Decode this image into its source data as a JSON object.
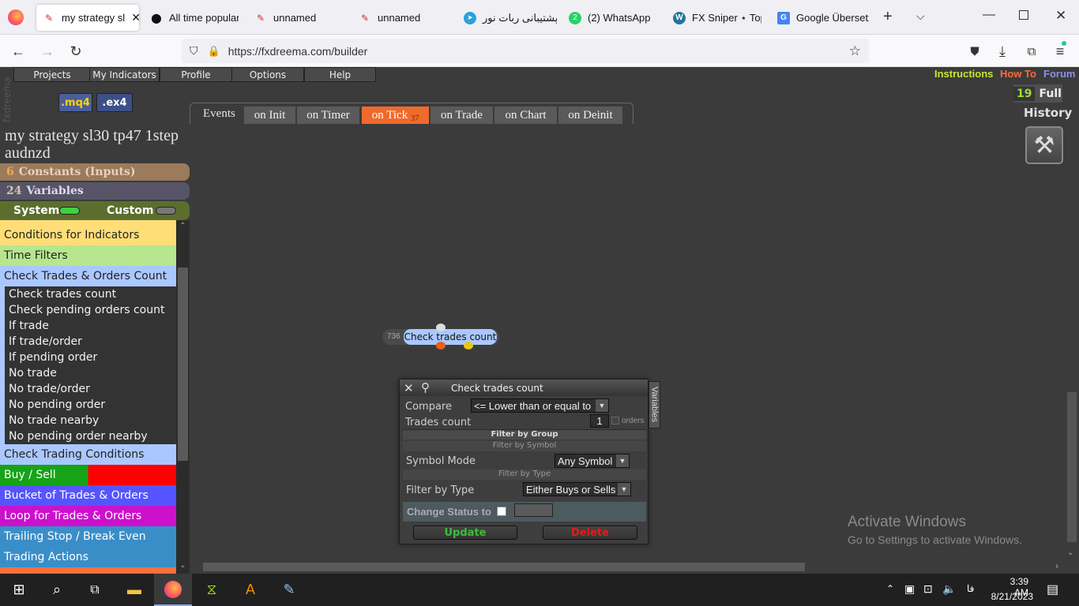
{
  "browser": {
    "tabs": [
      {
        "title": "my strategy sl",
        "active": true
      },
      {
        "title": "All time popular t"
      },
      {
        "title": "unnamed"
      },
      {
        "title": "unnamed"
      },
      {
        "title": "پشتیبانی ربات نور"
      },
      {
        "title": "(2) WhatsApp",
        "badge": "2"
      },
      {
        "title": "FX Sniper ⋆ Top M"
      },
      {
        "title": "Google Übersetze"
      }
    ],
    "url": "https://fxdreema.com/builder"
  },
  "app": {
    "logo": "fxdreema",
    "menu": [
      "Projects",
      "My Indicators",
      "Profile",
      "Options",
      "Help"
    ],
    "links": {
      "instructions": "Instructions",
      "howto": "How To",
      "forum": "Forum"
    },
    "downloads": {
      "mq4": ".mq4",
      "ex4": ".ex4"
    },
    "history": {
      "count": "19",
      "full": "Full",
      "label": "History"
    },
    "event_tabs": {
      "label": "Events",
      "tabs": [
        "on Init",
        "on Timer",
        "on Tick",
        "on Trade",
        "on Chart",
        "on Deinit"
      ],
      "active": "on Tick",
      "tick_badge": "37"
    },
    "strategy_title": "my strategy sl30 tp47 1step audnzd",
    "constants": {
      "count": "6",
      "label": "Constants (Inputs)"
    },
    "variables": {
      "count": "24",
      "label": "Variables"
    },
    "toggles": {
      "system": "System",
      "custom": "Custom"
    },
    "categories": [
      {
        "label": "Conditions for Indicators",
        "color": "#ffdd77"
      },
      {
        "label": "Time Filters",
        "color": "#b8e68e"
      },
      {
        "label": "Check Trades & Orders Count",
        "color": "#aac8ff"
      }
    ],
    "subitems": [
      "Check trades count",
      "Check pending orders count",
      "If trade",
      "If trade/order",
      "If pending order",
      "No trade",
      "No trade/order",
      "No pending order",
      "No trade nearby",
      "No pending order nearby"
    ],
    "categories2": [
      {
        "label": "Check Trading Conditions",
        "color": "#aac8ff"
      },
      {
        "label": "Buy / Sell",
        "color": "#17a317"
      },
      {
        "label": "Bucket of Trades & Orders",
        "color": "#5555ff"
      },
      {
        "label": "Loop for Trades & Orders",
        "color": "#cc11cc"
      },
      {
        "label": "Trailing Stop / Break Even",
        "color": "#3a8ec8"
      },
      {
        "label": "Trading Actions",
        "color": "#3a8ec8"
      }
    ],
    "block": {
      "id": "736",
      "label": "Check trades count"
    },
    "dialog": {
      "title": "Check trades count",
      "side_tab": "Variables",
      "compare_label": "Compare",
      "compare_value": "<= Lower than or equal to",
      "trades_label": "Trades count",
      "trades_value": "1",
      "orders_label": "orders",
      "filter_group": "Filter by Group",
      "filter_symbol": "Filter by Symbol",
      "symbol_mode_label": "Symbol Mode",
      "symbol_mode_value": "Any Symbol",
      "filter_type_header": "Filter by Type",
      "filter_type_label": "Filter by Type",
      "filter_type_value": "Either Buys or Sells",
      "change_status": "Change Status to",
      "update": "Update",
      "delete": "Delete"
    },
    "watermark": {
      "line1": "Activate Windows",
      "line2": "Go to Settings to activate Windows."
    }
  },
  "taskbar": {
    "time": "3:39 AM",
    "date": "8/21/2023",
    "lang": "فا"
  }
}
